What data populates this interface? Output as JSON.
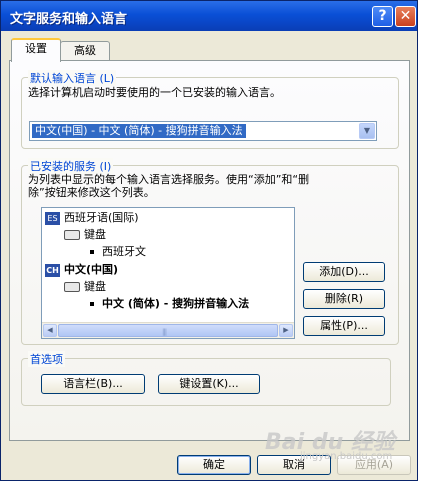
{
  "window": {
    "title": "文字服务和输入语言",
    "help_label": "?",
    "close_label": "✕"
  },
  "tabs": [
    {
      "label": "设置"
    },
    {
      "label": "高级"
    }
  ],
  "default_lang": {
    "legend": "默认输入语言 (L)",
    "description": "选择计算机启动时要使用的一个已安装的输入语言。",
    "selected": "中文(中国) - 中文 (简体) - 搜狗拼音输入法",
    "dropdown_glyph": "▼"
  },
  "installed": {
    "legend": "已安装的服务 (I)",
    "description_line1": "为列表中显示的每个输入语言选择服务。使用“添加”和“删",
    "description_line2": "除”按钮来修改这个列表。",
    "tree": [
      {
        "badge": "ES",
        "label": "西班牙语(国际)"
      },
      {
        "label": "键盘"
      },
      {
        "label": "西班牙文"
      },
      {
        "badge": "CH",
        "label": "中文(中国)"
      },
      {
        "label": "键盘"
      },
      {
        "label": "中文 (简体) - 搜狗拼音输入法"
      }
    ],
    "scroll_left": "◀",
    "scroll_right": "▶",
    "scroll_grip": "|||",
    "buttons": {
      "add": "添加(D)...",
      "remove": "删除(R)",
      "properties": "属性(P)..."
    }
  },
  "preferences": {
    "legend": "首选项",
    "language_bar": "语言栏(B)...",
    "key_settings": "键设置(K)..."
  },
  "footer": {
    "ok": "确定",
    "cancel": "取消",
    "apply": "应用(A)"
  },
  "watermark": {
    "main": "Bai du 经验",
    "sub": "jingyan.baidu.com"
  }
}
